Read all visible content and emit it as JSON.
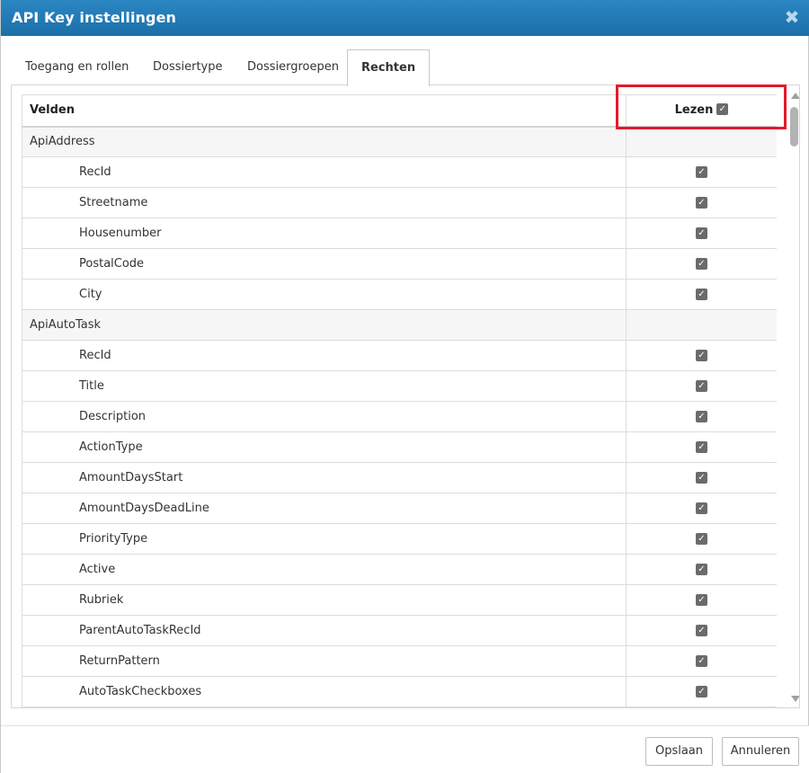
{
  "dialog": {
    "title": "API Key instellingen",
    "close_glyph": "✖"
  },
  "tabs": [
    {
      "label": "Toegang en rollen",
      "active": false
    },
    {
      "label": "Dossiertype",
      "active": false
    },
    {
      "label": "Dossiergroepen",
      "active": false
    },
    {
      "label": "Rechten",
      "active": true
    }
  ],
  "table": {
    "headers": {
      "field": "Velden",
      "read": "Lezen"
    },
    "header_read_checked": true,
    "groups": [
      {
        "name": "ApiAddress",
        "fields": [
          {
            "name": "RecId",
            "read": true
          },
          {
            "name": "Streetname",
            "read": true
          },
          {
            "name": "Housenumber",
            "read": true
          },
          {
            "name": "PostalCode",
            "read": true
          },
          {
            "name": "City",
            "read": true
          }
        ]
      },
      {
        "name": "ApiAutoTask",
        "fields": [
          {
            "name": "RecId",
            "read": true
          },
          {
            "name": "Title",
            "read": true
          },
          {
            "name": "Description",
            "read": true
          },
          {
            "name": "ActionType",
            "read": true
          },
          {
            "name": "AmountDaysStart",
            "read": true
          },
          {
            "name": "AmountDaysDeadLine",
            "read": true
          },
          {
            "name": "PriorityType",
            "read": true
          },
          {
            "name": "Active",
            "read": true
          },
          {
            "name": "Rubriek",
            "read": true
          },
          {
            "name": "ParentAutoTaskRecId",
            "read": true
          },
          {
            "name": "ReturnPattern",
            "read": true
          },
          {
            "name": "AutoTaskCheckboxes",
            "read": true
          }
        ]
      }
    ]
  },
  "footer": {
    "save_label": "Opslaan",
    "cancel_label": "Annuleren"
  },
  "colors": {
    "titlebar": "#1f78b4",
    "highlight": "#e21a2b",
    "checkbox": "#6b6b6b"
  }
}
